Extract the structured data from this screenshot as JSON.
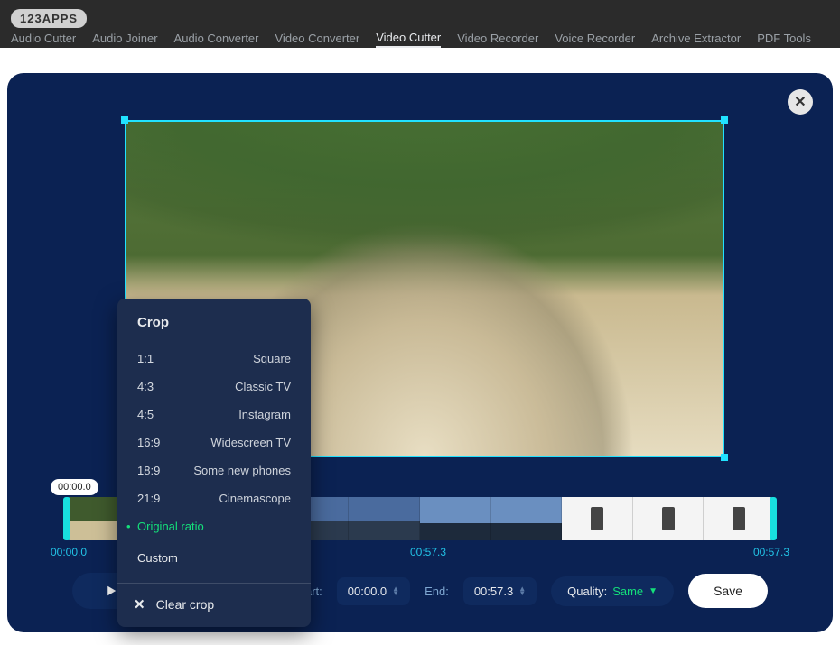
{
  "header": {
    "logo": "123APPS",
    "nav": [
      "Audio Cutter",
      "Audio Joiner",
      "Audio Converter",
      "Video Converter",
      "Video Cutter",
      "Video Recorder",
      "Voice Recorder",
      "Archive Extractor",
      "PDF Tools"
    ],
    "active_index": 4
  },
  "crop_popover": {
    "title": "Crop",
    "ratios": [
      {
        "ratio": "1:1",
        "label": "Square"
      },
      {
        "ratio": "4:3",
        "label": "Classic TV"
      },
      {
        "ratio": "4:5",
        "label": "Instagram"
      },
      {
        "ratio": "16:9",
        "label": "Widescreen TV"
      },
      {
        "ratio": "18:9",
        "label": "Some new phones"
      },
      {
        "ratio": "21:9",
        "label": "Cinemascope"
      }
    ],
    "selected_label": "Original ratio",
    "custom_label": "Custom",
    "clear_label": "Clear crop"
  },
  "timeline": {
    "pill": "00:00.0",
    "start_label": "00:00.0",
    "mid_label": "00:57.3",
    "end_label": "00:57.3"
  },
  "controls": {
    "start_lbl": "Start:",
    "start_val": "00:00.0",
    "end_lbl": "End:",
    "end_val": "00:57.3",
    "quality_lbl": "Quality:",
    "quality_val": "Same",
    "save": "Save"
  }
}
